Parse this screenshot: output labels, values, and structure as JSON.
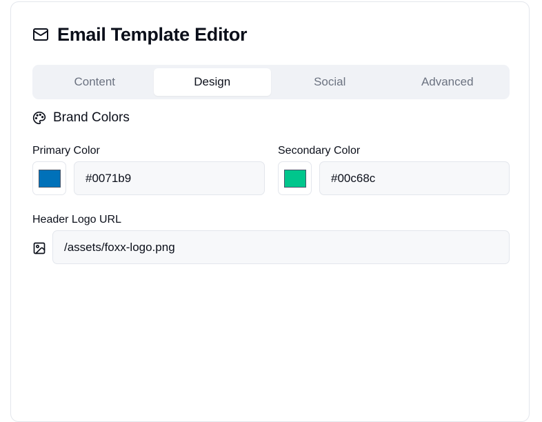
{
  "header": {
    "title": "Email Template Editor",
    "icon": "mail-icon"
  },
  "tabs": [
    {
      "label": "Content",
      "active": false
    },
    {
      "label": "Design",
      "active": true
    },
    {
      "label": "Social",
      "active": false
    },
    {
      "label": "Advanced",
      "active": false
    }
  ],
  "section": {
    "title": "Brand Colors",
    "icon": "palette-icon"
  },
  "primary_color": {
    "label": "Primary Color",
    "value": "#0071b9"
  },
  "secondary_color": {
    "label": "Secondary Color",
    "value": "#00c68c"
  },
  "logo": {
    "label": "Header Logo URL",
    "value": "/assets/foxx-logo.png",
    "icon": "image-icon"
  }
}
